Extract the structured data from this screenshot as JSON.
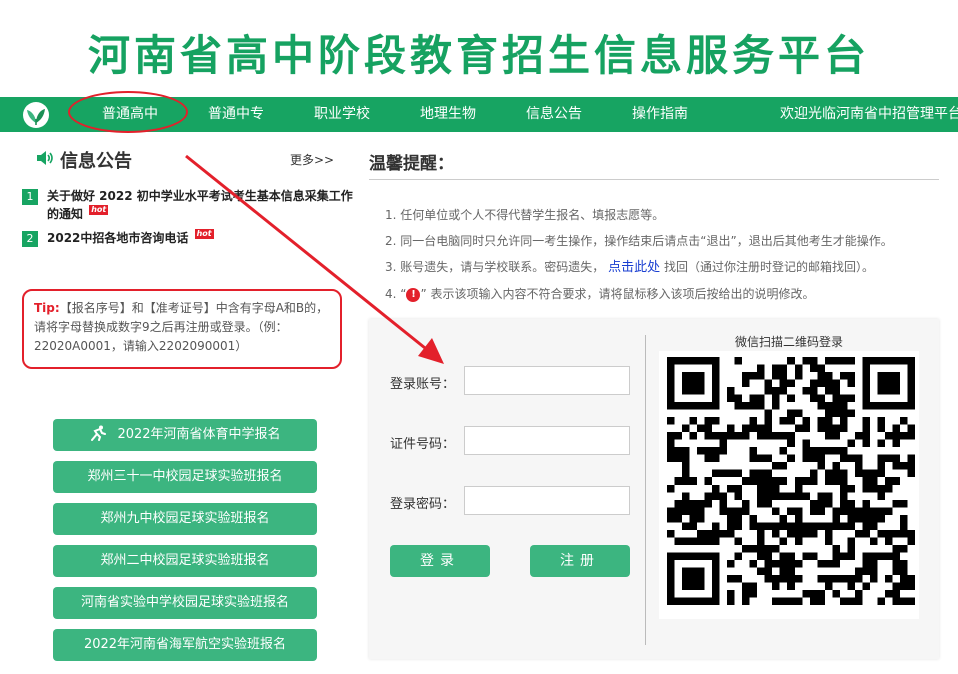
{
  "header": {
    "title": "河南省高中阶段教育招生信息服务平台"
  },
  "nav": {
    "items": [
      "普通高中",
      "普通中专",
      "职业学校",
      "地理生物",
      "信息公告",
      "操作指南"
    ],
    "welcome": "欢迎光临河南省中招管理平台"
  },
  "notices": {
    "title": "信息公告",
    "more": "更多>>",
    "hot_label": "hot",
    "items": [
      {
        "num": "1",
        "text": "关于做好 2022 初中学业水平考试考生基本信息采集工作的通知"
      },
      {
        "num": "2",
        "text": "2022中招各地市咨询电话"
      }
    ]
  },
  "tip": {
    "label": "Tip:",
    "text": "【报名序号】和【准考证号】中含有字母A和B的，请将字母替换成数字9之后再注册或登录。（例：22020A0001，请输入2202090001）"
  },
  "side_buttons": [
    "2022年河南省体育中学报名",
    "郑州三十一中校园足球实验班报名",
    "郑州九中校园足球实验班报名",
    "郑州二中校园足球实验班报名",
    "河南省实验中学校园足球实验班报名",
    "2022年河南省海军航空实验班报名"
  ],
  "reminder": {
    "title": "温馨提醒：",
    "line1": "1. 任何单位或个人不得代替学生报名、填报志愿等。",
    "line2": "2. 同一台电脑同时只允许同一考生操作，操作结束后请点击“退出”，退出后其他考生才能操作。",
    "line3_pre": "3. 账号遗失，请与学校联系。密码遗失，",
    "line3_link": "点击此处",
    "line3_post": "找回（通过你注册时登记的邮箱找回）。",
    "line4_pre": "4. “",
    "line4_icon": "!",
    "line4_post": "” 表示该项输入内容不符合要求，请将鼠标移入该项后按给出的说明修改。"
  },
  "login": {
    "account_label": "登录账号：",
    "id_label": "证件号码：",
    "password_label": "登录密码：",
    "account_value": "",
    "id_value": "",
    "password_value": "",
    "login_button": "登录",
    "register_button": "注册"
  },
  "qr": {
    "caption": "微信扫描二维码登录"
  },
  "colors": {
    "brand_green": "#17a462",
    "button_green": "#3cb580",
    "alert_red": "#e3202b",
    "link_blue": "#1a3fd1"
  }
}
